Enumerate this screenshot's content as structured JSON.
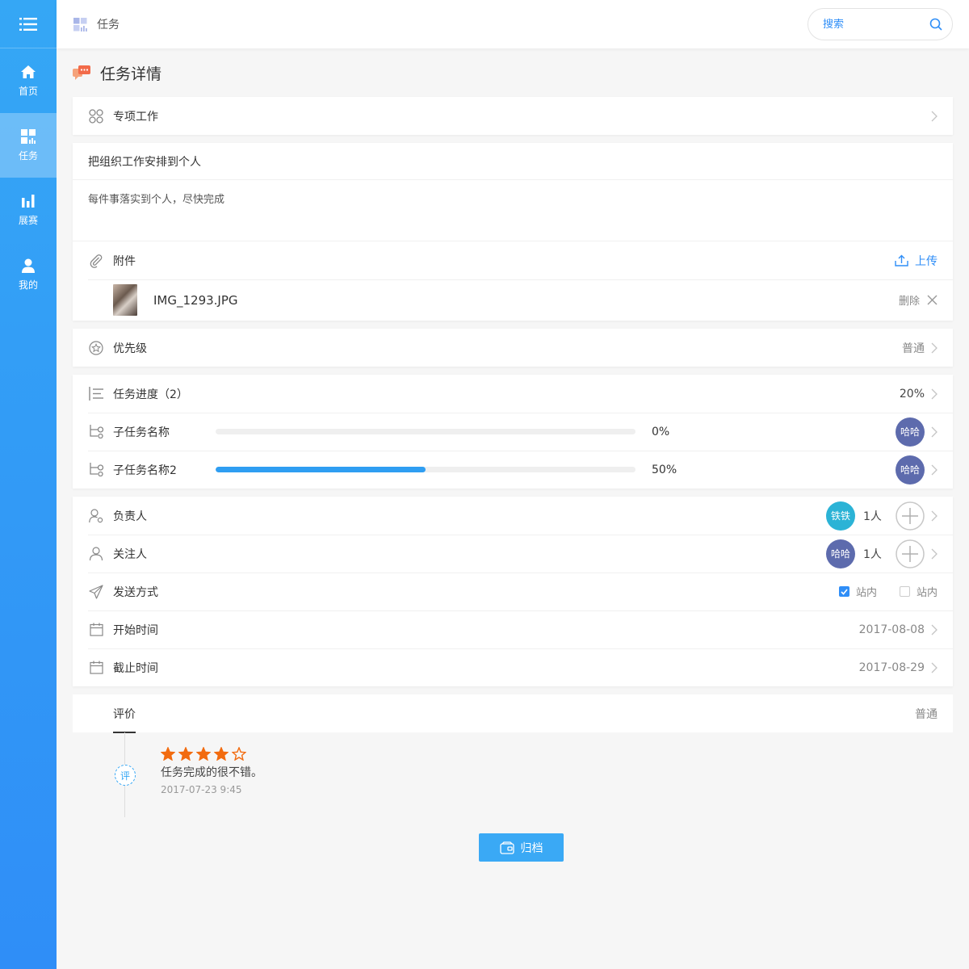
{
  "sidebar": {
    "items": [
      {
        "label": "首页",
        "icon": "home-icon"
      },
      {
        "label": "任务",
        "icon": "grid-icon",
        "active": true
      },
      {
        "label": "展赛",
        "icon": "bar-chart-icon"
      },
      {
        "label": "我的",
        "icon": "user-icon"
      }
    ]
  },
  "header": {
    "title": "任务",
    "search_placeholder": "搜索"
  },
  "page": {
    "title": "任务详情"
  },
  "special": {
    "label": "专项工作"
  },
  "task": {
    "title": "把组织工作安排到个人",
    "description": "每件事落实到个人，尽快完成"
  },
  "attachment": {
    "label": "附件",
    "upload_label": "上传",
    "file_name": "IMG_1293.JPG",
    "delete_label": "删除"
  },
  "priority": {
    "label": "优先级",
    "value": "普通"
  },
  "progress": {
    "label": "任务进度（2）",
    "value": "20%",
    "subtasks": [
      {
        "name": "子任务名称",
        "percent": 0,
        "percent_label": "0%",
        "avatar": "哈哈"
      },
      {
        "name": "子任务名称2",
        "percent": 50,
        "percent_label": "50%",
        "avatar": "哈哈"
      }
    ]
  },
  "owner": {
    "label": "负责人",
    "avatar": "铁铁",
    "count": "1人"
  },
  "follower": {
    "label": "关注人",
    "avatar": "哈哈",
    "count": "1人"
  },
  "send": {
    "label": "发送方式",
    "options": [
      {
        "label": "站内",
        "checked": true
      },
      {
        "label": "站内",
        "checked": false
      }
    ]
  },
  "start": {
    "label": "开始时间",
    "value": "2017-08-08"
  },
  "end": {
    "label": "截止时间",
    "value": "2017-08-29"
  },
  "evaluation": {
    "label": "评价",
    "value": "普通",
    "badge": "评",
    "stars": 4,
    "stars_max": 5,
    "comment": "任务完成的很不错。",
    "time": "2017-07-23 9:45"
  },
  "archive": {
    "label": "归档"
  },
  "colors": {
    "accent": "#2f8ef7",
    "star": "#f26b0f",
    "avatar_purple": "#5d6bad",
    "avatar_teal": "#2bb3d6"
  }
}
